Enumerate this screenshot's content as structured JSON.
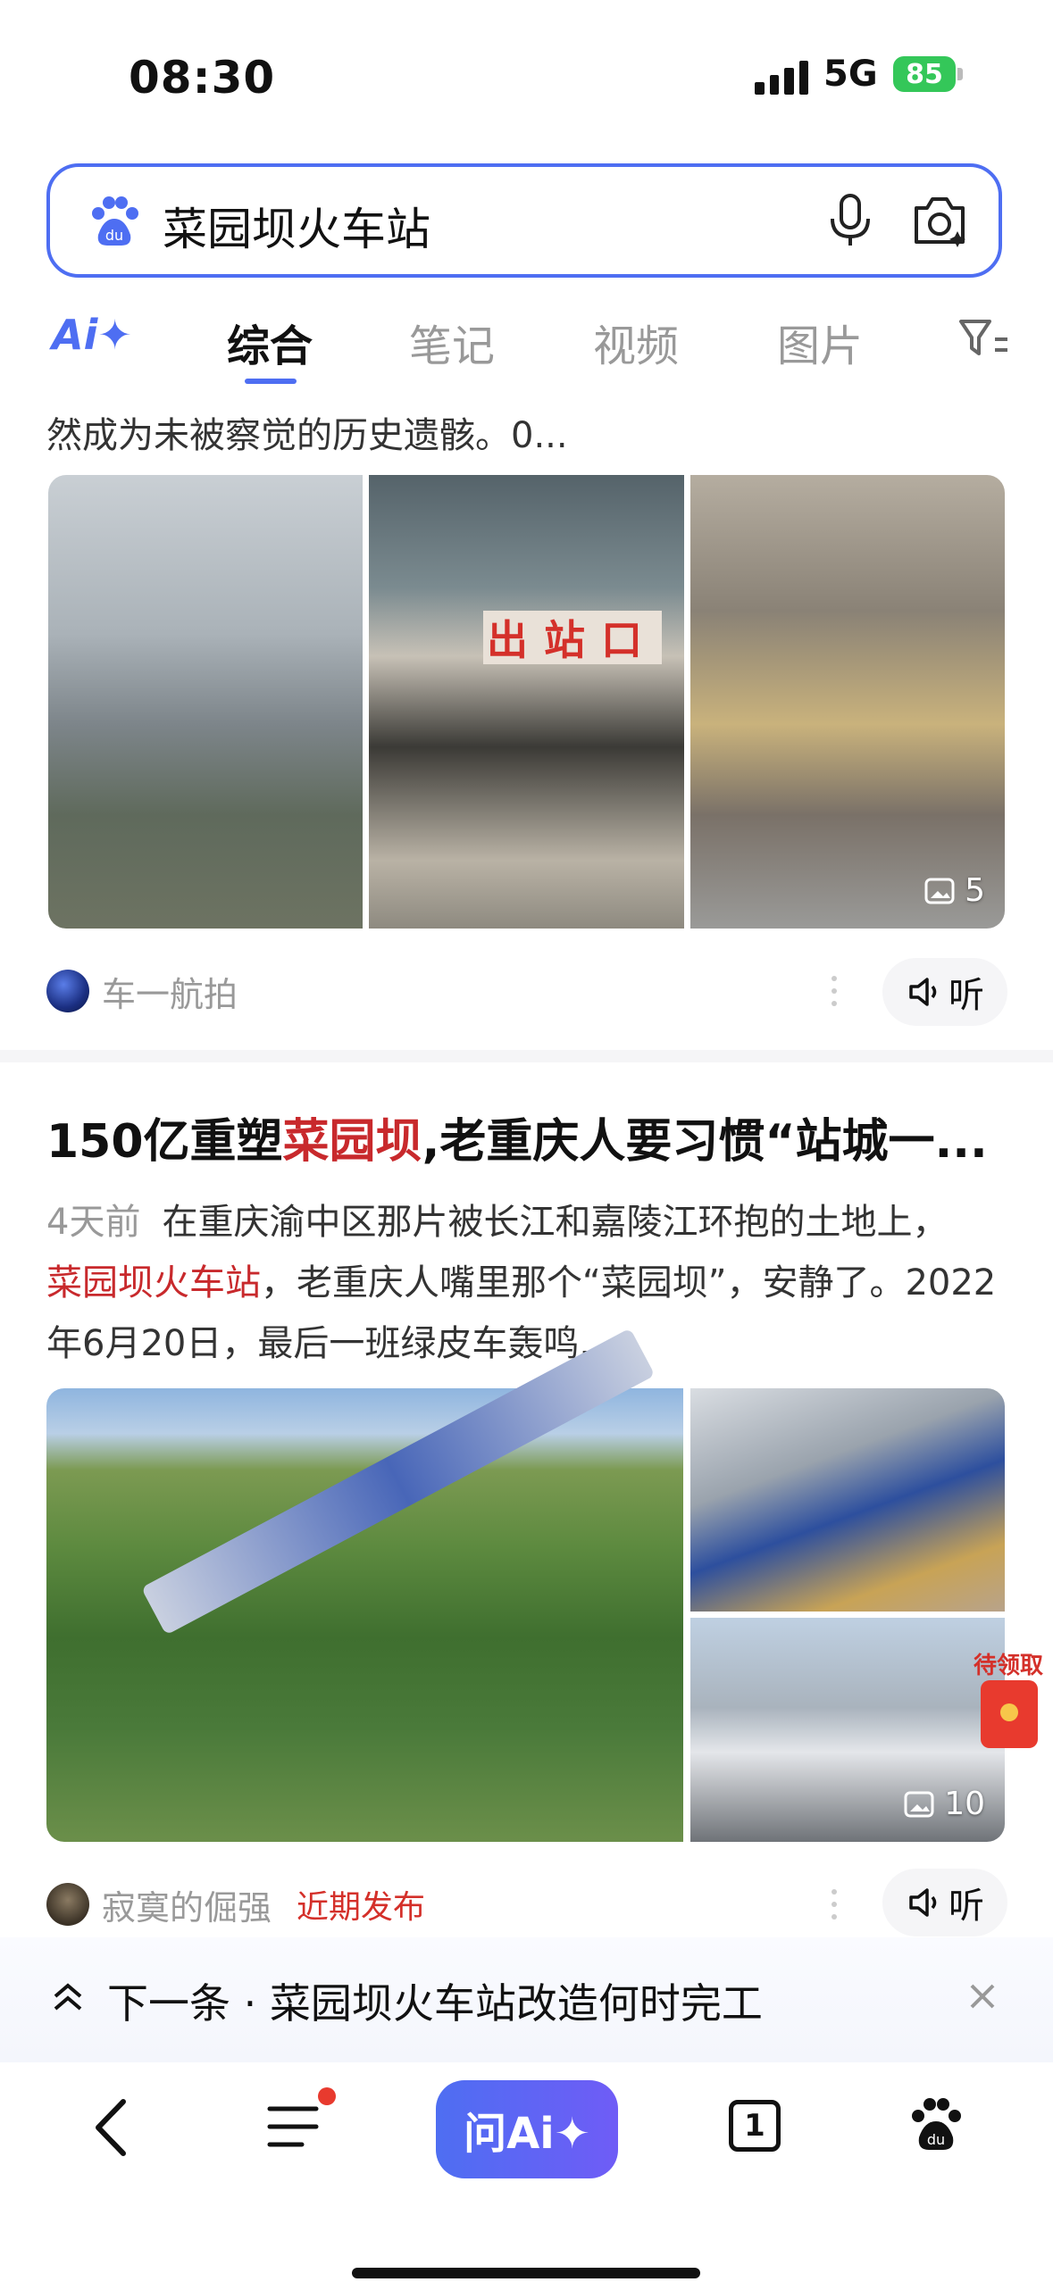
{
  "status": {
    "time": "08:30",
    "network": "5G",
    "battery": "85"
  },
  "search": {
    "query": "菜园坝火车站"
  },
  "tabs": {
    "ai": "Ai✦",
    "items": [
      "综合",
      "笔记",
      "视频",
      "图片"
    ]
  },
  "result1": {
    "snippet_tail": "然成为未被察觉的历史遗骸。0...",
    "sign_text": "出站口",
    "image_count": "5",
    "author": "车一航拍",
    "listen_label": "听"
  },
  "result2": {
    "headline_prefix": "150亿重塑",
    "headline_highlight": "菜园坝",
    "headline_suffix": ",老重庆人要习惯“站城一...",
    "date": "4天前",
    "summary_part1": "在重庆渝中区那片被长江和嘉陵江环抱的土地上，",
    "summary_highlight": "菜园坝火车站",
    "summary_part2": "，老重庆人嘴里那个“菜园坝”，安静了。2022年6月20日，最后一班绿皮车轰鸣...",
    "image_count": "10",
    "author": "寂寞的倔强",
    "badge": "近期发布",
    "listen_label": "听"
  },
  "floating": {
    "pending_label": "待领取"
  },
  "next": {
    "text": "下一条 · 菜园坝火车站改造何时完工"
  },
  "toolbar": {
    "ask_ai_label": "问Ai✦",
    "tab_count": "1"
  },
  "colors": {
    "brand": "#4e6ef2",
    "highlight": "#c8292c",
    "badge": "#34c759"
  }
}
